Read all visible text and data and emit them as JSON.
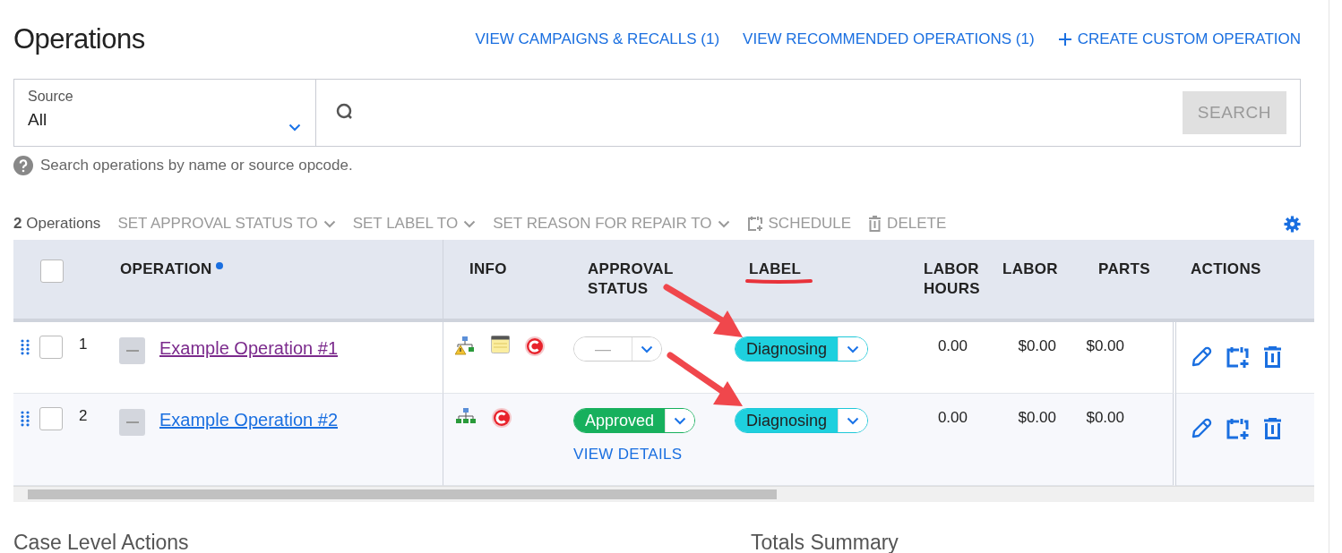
{
  "header": {
    "title": "Operations",
    "links": [
      {
        "label": "VIEW CAMPAIGNS & RECALLS (1)",
        "kind": "link"
      },
      {
        "label": "VIEW RECOMMENDED OPERATIONS (1)",
        "kind": "link"
      },
      {
        "label": "CREATE CUSTOM OPERATION",
        "kind": "add"
      }
    ]
  },
  "filter": {
    "label": "Source",
    "value": "All"
  },
  "search": {
    "button": "SEARCH",
    "disabled": true
  },
  "help_text": "Search operations by name or source opcode.",
  "toolbar": {
    "count": "2",
    "count_label": "Operations",
    "actions": [
      {
        "label": "SET APPROVAL STATUS TO",
        "kind": "menu"
      },
      {
        "label": "SET LABEL TO",
        "kind": "menu"
      },
      {
        "label": "SET REASON FOR REPAIR TO",
        "kind": "menu"
      },
      {
        "label": "SCHEDULE",
        "kind": "schedule"
      },
      {
        "label": "DELETE",
        "kind": "delete"
      }
    ]
  },
  "table": {
    "select_all": {
      "checked": false
    },
    "columns": [
      {
        "label": "OPERATION",
        "marked": true
      },
      {
        "label": "INFO",
        "marked": false
      },
      {
        "label": "APPROVAL STATUS",
        "marked": false
      },
      {
        "label": "LABEL",
        "marked": false
      },
      {
        "label": "LABOR HOURS",
        "marked": false
      },
      {
        "label": "LABOR",
        "marked": false
      },
      {
        "label": "PARTS",
        "marked": false
      },
      {
        "label": "ACTIONS",
        "marked": false
      }
    ],
    "rows": [
      {
        "number": "1",
        "checked": false,
        "visited": true,
        "name": "Example Operation #1",
        "info": [
          {
            "kind": "network-warning"
          },
          {
            "kind": "note"
          },
          {
            "kind": "recall"
          }
        ],
        "approval": {
          "value": "—",
          "kind": "none"
        },
        "label": "Diagnosing",
        "labor_hours": "0.00",
        "labor": "$0.00",
        "parts": "$0.00"
      },
      {
        "number": "2",
        "checked": false,
        "visited": false,
        "name": "Example Operation #2",
        "info": [
          {
            "kind": "network"
          },
          {
            "kind": "recall"
          }
        ],
        "approval": {
          "value": "Approved",
          "kind": "approved",
          "link": "VIEW DETAILS"
        },
        "label": "Diagnosing",
        "labor_hours": "0.00",
        "labor": "$0.00",
        "parts": "$0.00"
      }
    ]
  },
  "sections": [
    "Case Level Actions",
    "Totals Summary"
  ]
}
